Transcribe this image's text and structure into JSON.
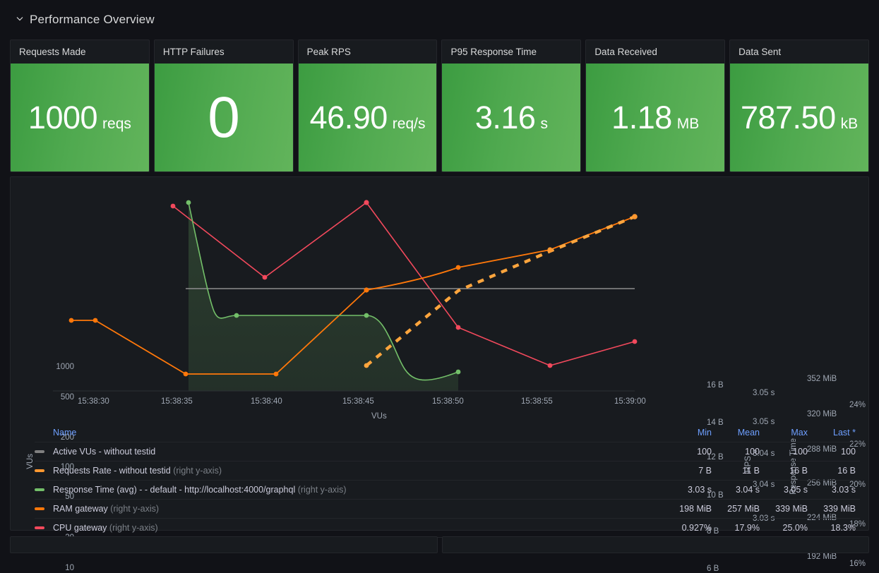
{
  "row": {
    "title": "Performance Overview",
    "collapse_icon": "chevron-down-icon",
    "expanded": true
  },
  "stats": [
    {
      "title": "Requests Made",
      "value": "1000",
      "unit": "reqs",
      "big": false,
      "color": "#4fa94f"
    },
    {
      "title": "HTTP Failures",
      "value": "0",
      "unit": "",
      "big": true,
      "color": "#4fa94f"
    },
    {
      "title": "Peak RPS",
      "value": "46.90",
      "unit": "req/s",
      "big": false,
      "color": "#4fa94f"
    },
    {
      "title": "P95 Response Time",
      "value": "3.16",
      "unit": "s",
      "big": false,
      "color": "#4fa94f"
    },
    {
      "title": "Data Received",
      "value": "1.18",
      "unit": "MB",
      "big": false,
      "color": "#4fa94f"
    },
    {
      "title": "Data Sent",
      "value": "787.50",
      "unit": "kB",
      "big": false,
      "color": "#4fa94f"
    }
  ],
  "chart_data": {
    "type": "line",
    "title": "",
    "xlabel": "VUs",
    "x_ticks": [
      "15:38:30",
      "15:38:35",
      "15:38:40",
      "15:38:45",
      "15:38:50",
      "15:38:55",
      "15:39:00"
    ],
    "grid": false,
    "legend_position": "bottom-table",
    "axes": [
      {
        "name": "VUs",
        "side": "left",
        "scale": "log",
        "ticks": [
          "1000",
          "500",
          "200",
          "100",
          "50",
          "20",
          "10"
        ]
      },
      {
        "name": "RPS",
        "side": "right",
        "scale": "linear",
        "ticks": [
          "16 B",
          "14 B",
          "12 B",
          "10 B",
          "8 B",
          "6 B"
        ]
      },
      {
        "name": "Response Time",
        "side": "right",
        "scale": "linear",
        "ticks": [
          "3.05 s",
          "3.05 s",
          "3.04 s",
          "3.04 s",
          "3.03 s",
          "3.03 s"
        ]
      },
      {
        "name": "",
        "side": "right",
        "scale": "linear",
        "ticks": [
          "352 MiB",
          "320 MiB",
          "288 MiB",
          "256 MiB",
          "224 MiB",
          "192 MiB"
        ]
      },
      {
        "name": "",
        "side": "right",
        "scale": "linear",
        "ticks": [
          "24%",
          "22%",
          "20%",
          "18%",
          "16%"
        ]
      }
    ],
    "series": [
      {
        "name": "Active VUs - without testid",
        "color": "#808080",
        "style": "solid",
        "fill": false,
        "axis": "VUs",
        "x": [
          "15:38:45",
          "15:39:00"
        ],
        "values": [
          100,
          100
        ]
      },
      {
        "name": "Requests Rate - without testid",
        "color": "#FF9830",
        "style": "dashed",
        "fill": false,
        "axis": "RPS",
        "x": [
          "15:38:45",
          "15:38:50",
          "15:38:55",
          "15:39:00"
        ],
        "values": [
          7,
          11,
          14,
          16
        ]
      },
      {
        "name": "Response Time (avg) - - default - http://localhost:4000/graphql",
        "color": "#73BF69",
        "style": "solid-smooth",
        "fill": true,
        "axis": "Response Time",
        "x": [
          "15:38:45",
          "15:38:50",
          "15:38:55",
          "15:39:00"
        ],
        "values": [
          3.05,
          3.04,
          3.04,
          3.03
        ]
      },
      {
        "name": "RAM gateway",
        "color": "#FF780A",
        "style": "solid",
        "fill": false,
        "axis": "MiB",
        "x": [
          "15:38:30",
          "15:38:35",
          "15:38:40",
          "15:38:45",
          "15:38:50",
          "15:38:55",
          "15:39:00"
        ],
        "values": [
          198,
          198,
          198,
          257,
          270,
          300,
          339
        ]
      },
      {
        "name": "CPU gateway",
        "color": "#F2495C",
        "style": "solid",
        "fill": false,
        "axis": "%",
        "x": [
          "15:38:35",
          "15:38:40",
          "15:38:45",
          "15:38:50",
          "15:38:55",
          "15:39:00"
        ],
        "values": [
          25.0,
          20.0,
          24.0,
          19.0,
          0.927,
          18.3
        ]
      }
    ]
  },
  "legend": {
    "columns": [
      "Name",
      "Min",
      "Mean",
      "Max",
      "Last *"
    ],
    "rows": [
      {
        "color": "#808080",
        "name": "Active VUs - without testid",
        "axis_note": "",
        "min": "100",
        "mean": "100",
        "max": "100",
        "last": "100"
      },
      {
        "color": "#FF9830",
        "name": "Requests Rate - without testid",
        "axis_note": "(right y-axis)",
        "min": "7 B",
        "mean": "11 B",
        "max": "16 B",
        "last": "16 B"
      },
      {
        "color": "#73BF69",
        "name": "Response Time (avg) - - default - http://localhost:4000/graphql",
        "axis_note": "(right y-axis)",
        "min": "3.03 s",
        "mean": "3.04 s",
        "max": "3.05 s",
        "last": "3.03 s"
      },
      {
        "color": "#FF780A",
        "name": "RAM gateway",
        "axis_note": "(right y-axis)",
        "min": "198 MiB",
        "mean": "257 MiB",
        "max": "339 MiB",
        "last": "339 MiB"
      },
      {
        "color": "#F2495C",
        "name": "CPU gateway",
        "axis_note": "(right y-axis)",
        "min": "0.927%",
        "mean": "17.9%",
        "max": "25.0%",
        "last": "18.3%"
      }
    ]
  }
}
